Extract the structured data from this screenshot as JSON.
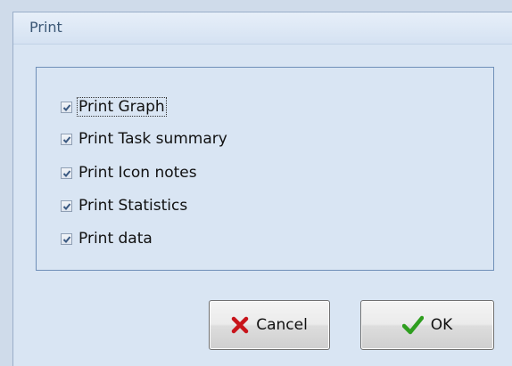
{
  "dialog": {
    "title": "Print"
  },
  "options": [
    {
      "label": "Print Graph",
      "checked": true,
      "focused": true
    },
    {
      "label": "Print Task summary",
      "checked": true,
      "focused": false
    },
    {
      "label": "Print Icon notes",
      "checked": true,
      "focused": false
    },
    {
      "label": "Print Statistics",
      "checked": true,
      "focused": false
    },
    {
      "label": "Print data",
      "checked": true,
      "focused": false
    }
  ],
  "buttons": {
    "cancel": {
      "label": "Cancel",
      "icon": "x-icon"
    },
    "ok": {
      "label": "OK",
      "icon": "checkmark-icon"
    }
  },
  "colors": {
    "cancel_icon": "#c8141b",
    "ok_icon": "#2e9e1f",
    "checkmark": "#3b5a82"
  }
}
